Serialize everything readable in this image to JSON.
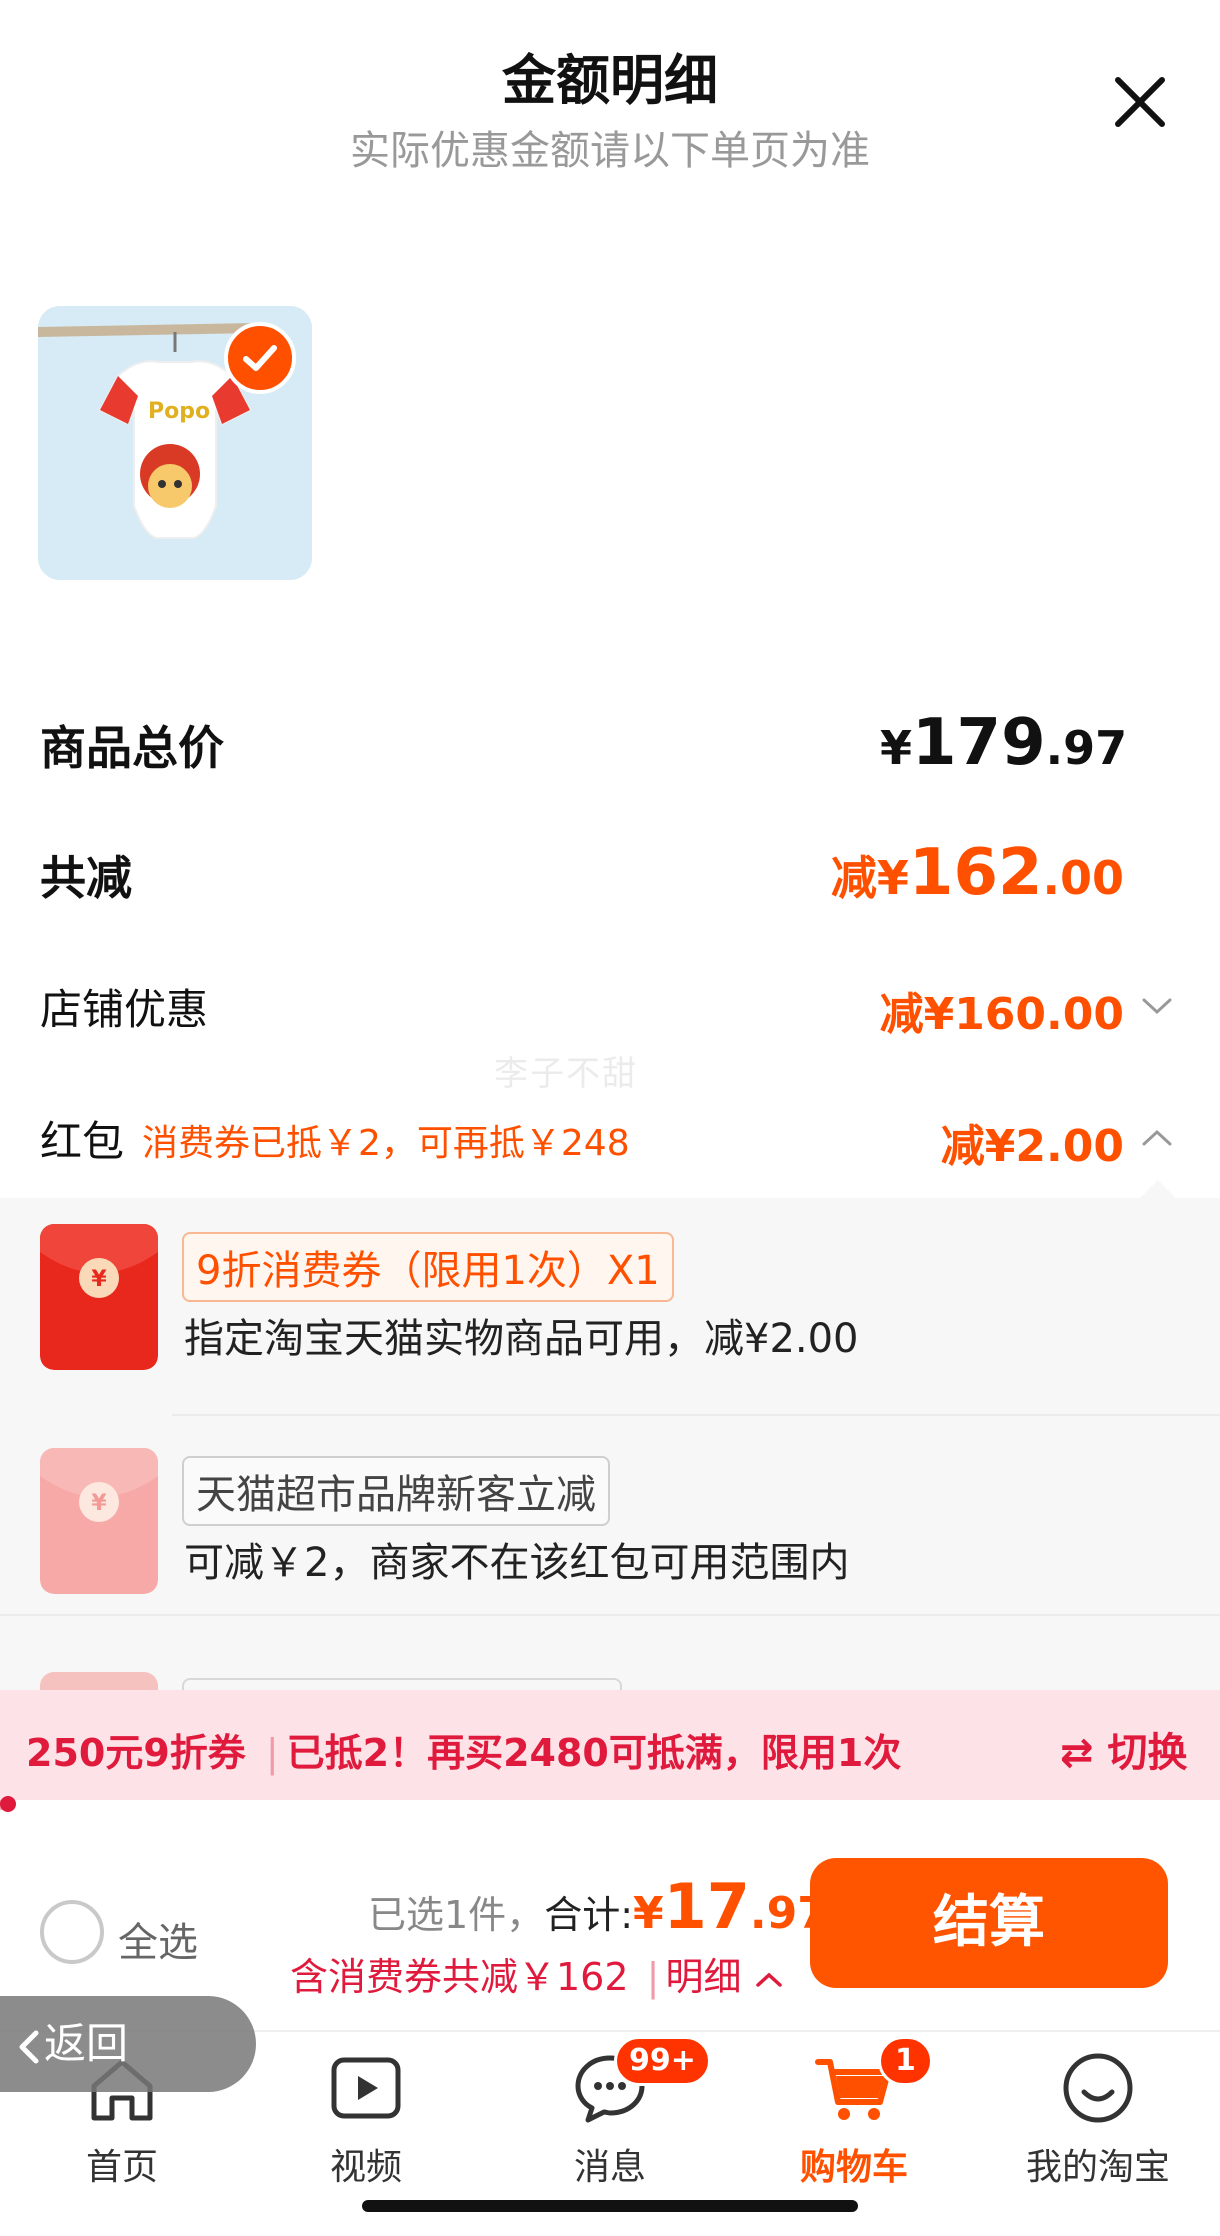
{
  "header": {
    "title": "金额明细",
    "subtitle": "实际优惠金额请以下单页为准"
  },
  "summary": {
    "total_label": "商品总价",
    "total_price": {
      "symbol": "¥",
      "int": "179",
      "dec": ".97"
    },
    "reduce_label": "共减",
    "reduce_price": {
      "prefix": "减",
      "symbol": "¥",
      "int": "162",
      "dec": ".00"
    },
    "shop_label": "店铺优惠",
    "shop_price": {
      "prefix": "减",
      "symbol": "¥",
      "int": "160",
      "dec": ".00"
    },
    "hongbao_label": "红包",
    "hongbao_note": "消费券已抵￥2，可再抵￥248",
    "hongbao_price": {
      "prefix": "减",
      "symbol": "¥",
      "int": "2",
      "dec": ".00"
    }
  },
  "watermark": "李子不甜",
  "coupons": [
    {
      "title": "9折消费券（限用1次）X1",
      "desc": "指定淘宝天猫实物商品可用，减¥2.00",
      "style": "active"
    },
    {
      "title": "天猫超市品牌新客立减",
      "desc": "可减￥2，商家不在该红包可用范围内",
      "style": "disabled"
    }
  ],
  "banner": {
    "coupon_name": "250元9折券",
    "text": "已抵2！再买2480可抵满，限用1次",
    "switch_label": "切换",
    "progress": 0.01
  },
  "checkout": {
    "select_all_label": "全选",
    "selected_text": "已选1件，",
    "total_label": "合计:",
    "total_price": {
      "symbol": "¥",
      "int": "17",
      "dec": ".97"
    },
    "discount_text": "含消费券共减￥162",
    "detail_label": "明细",
    "button_label": "结算"
  },
  "back_label": "返回",
  "tabs": [
    {
      "label": "首页",
      "icon": "home-icon"
    },
    {
      "label": "视频",
      "icon": "video-icon"
    },
    {
      "label": "消息",
      "icon": "message-icon",
      "badge": "99+"
    },
    {
      "label": "购物车",
      "icon": "cart-icon",
      "badge": "1",
      "active": true
    },
    {
      "label": "我的淘宝",
      "icon": "profile-icon"
    }
  ],
  "colors": {
    "accent": "#ff5000",
    "banner_red": "#e01a3c",
    "checkout_button": "#ff5500"
  }
}
